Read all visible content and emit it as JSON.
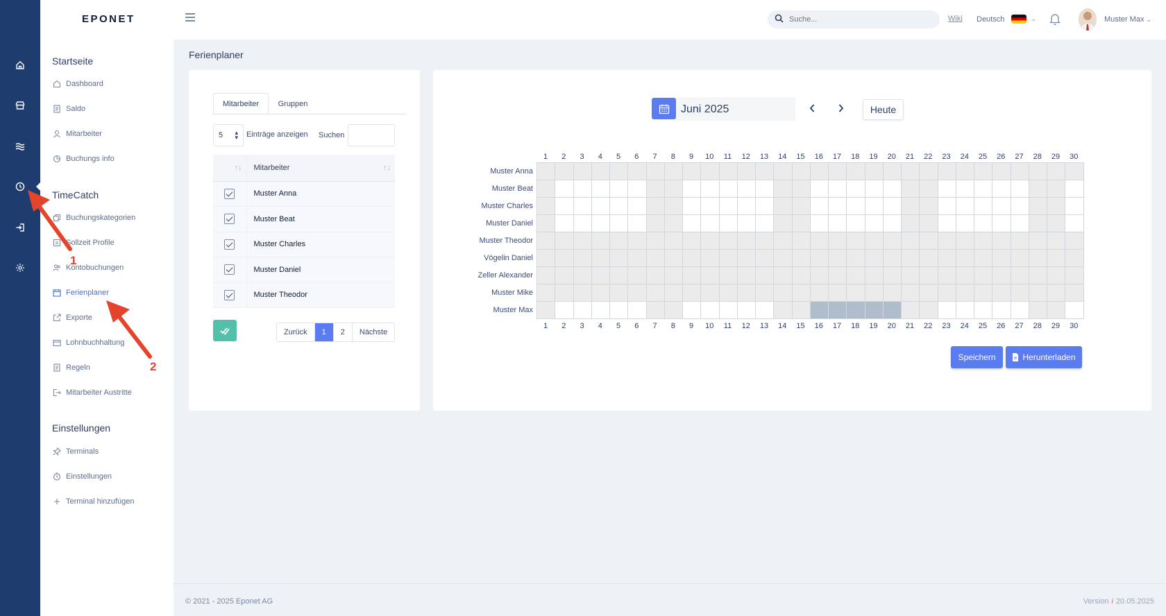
{
  "app": {
    "logo": "EPONET"
  },
  "rail": {
    "icons": [
      "home-icon",
      "store-icon",
      "waves-icon",
      "clock-icon",
      "login-icon",
      "gear-icon"
    ]
  },
  "sidebar": {
    "sections": [
      {
        "title": "Startseite",
        "items": [
          {
            "label": "Dashboard",
            "icon": "home-outline-icon"
          },
          {
            "label": "Saldo",
            "icon": "document-icon"
          },
          {
            "label": "Mitarbeiter",
            "icon": "user-icon"
          },
          {
            "label": "Buchungs info",
            "icon": "chart-icon"
          }
        ]
      },
      {
        "title": "TimeCatch",
        "items": [
          {
            "label": "Buchungskategorien",
            "icon": "copy-icon"
          },
          {
            "label": "Sollzeit Profile",
            "icon": "profile-icon"
          },
          {
            "label": "Kontobuchungen",
            "icon": "users-icon"
          },
          {
            "label": "Ferienplaner",
            "icon": "calendar-icon",
            "active": true
          },
          {
            "label": "Exporte",
            "icon": "export-icon"
          },
          {
            "label": "Lohnbuchhaltung",
            "icon": "wallet-icon"
          },
          {
            "label": "Regeln",
            "icon": "document-icon"
          },
          {
            "label": "Mitarbeiter Austritte",
            "icon": "logout-icon"
          }
        ]
      },
      {
        "title": "Einstellungen",
        "items": [
          {
            "label": "Terminals",
            "icon": "pin-icon"
          },
          {
            "label": "Einstellungen",
            "icon": "timer-icon"
          },
          {
            "label": "Terminal hinzufügen",
            "icon": "plus-icon"
          }
        ]
      }
    ]
  },
  "topbar": {
    "search_placeholder": "Suche...",
    "wiki": "Wiki",
    "language": "Deutsch",
    "user": "Muster Max"
  },
  "page": {
    "title": "Ferienplaner"
  },
  "left_panel": {
    "tabs": [
      "Mitarbeiter",
      "Gruppen"
    ],
    "entries_value": "5",
    "entries_label": "Einträge anzeigen",
    "search_label": "Suchen",
    "table": {
      "header": "Mitarbeiter",
      "rows": [
        {
          "name": "Muster Anna",
          "checked": true
        },
        {
          "name": "Muster Beat",
          "checked": true
        },
        {
          "name": "Muster Charles",
          "checked": true
        },
        {
          "name": "Muster Daniel",
          "checked": true
        },
        {
          "name": "Muster Theodor",
          "checked": true
        }
      ]
    },
    "pagination": {
      "prev": "Zurück",
      "pages": [
        "1",
        "2"
      ],
      "current": "1",
      "next": "Nächste"
    }
  },
  "calendar": {
    "month": "Juni 2025",
    "today_label": "Heute",
    "days": [
      "1",
      "2",
      "3",
      "4",
      "5",
      "6",
      "7",
      "8",
      "9",
      "10",
      "11",
      "12",
      "13",
      "14",
      "15",
      "16",
      "17",
      "18",
      "19",
      "20",
      "21",
      "22",
      "23",
      "24",
      "25",
      "26",
      "27",
      "28",
      "29",
      "30"
    ],
    "weekend_days": [
      1,
      7,
      8,
      14,
      15,
      21,
      22,
      28,
      29
    ],
    "employees": [
      {
        "name": "Muster Anna",
        "disabled": true,
        "vacation": []
      },
      {
        "name": "Muster Beat",
        "disabled": false,
        "vacation": []
      },
      {
        "name": "Muster Charles",
        "disabled": false,
        "vacation": []
      },
      {
        "name": "Muster Daniel",
        "disabled": false,
        "vacation": []
      },
      {
        "name": "Muster Theodor",
        "disabled": true,
        "vacation": []
      },
      {
        "name": "Vögelin Daniel",
        "disabled": true,
        "vacation": []
      },
      {
        "name": "Zeller Alexander",
        "disabled": true,
        "vacation": []
      },
      {
        "name": "Muster Mike",
        "disabled": true,
        "vacation": []
      },
      {
        "name": "Muster Max",
        "disabled": false,
        "vacation": [
          16,
          17,
          18,
          19,
          20
        ]
      }
    ],
    "save_label": "Speichern",
    "download_label": "Herunterladen"
  },
  "annotations": [
    "1",
    "2"
  ],
  "footer": {
    "copyright": "© 2021 - 2025 Eponet AG",
    "version_label": "Version",
    "version_date": "20.05.2025"
  },
  "colors": {
    "rail": "#1f3c6e",
    "accent": "#5b7cf0",
    "confirm": "#55c0a9",
    "vacation": "#aebccb",
    "weekend": "#ebebeb",
    "arrow": "#e4442b"
  }
}
